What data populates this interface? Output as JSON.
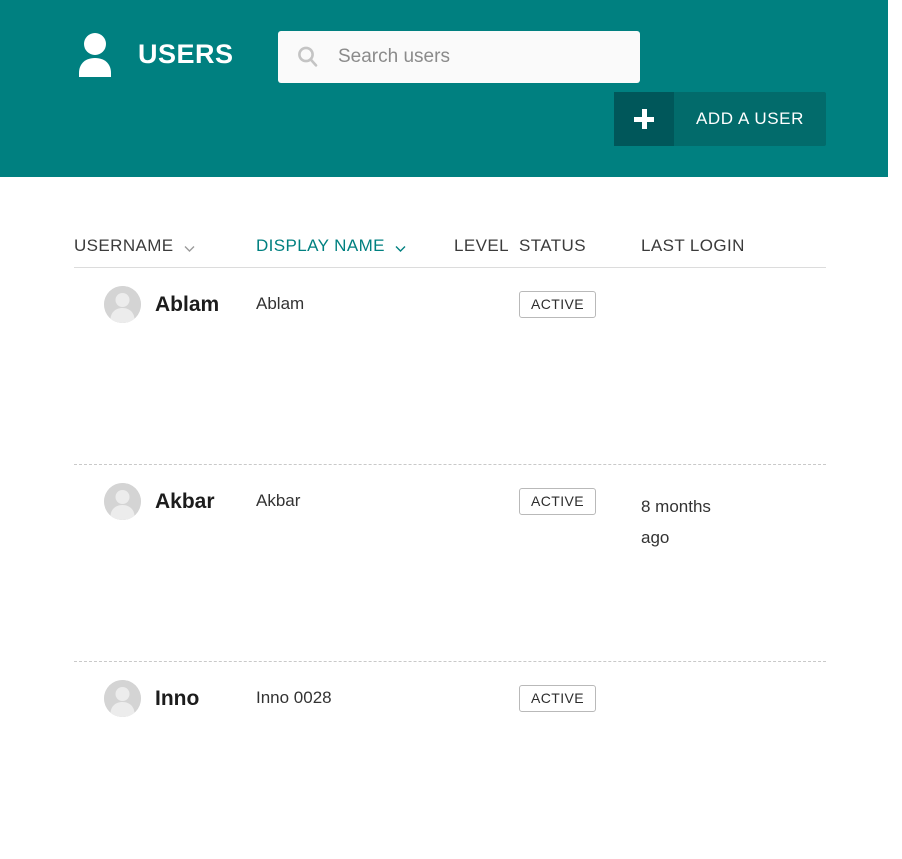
{
  "header": {
    "title": "USERS",
    "user_icon": "person-icon",
    "search": {
      "icon": "search-icon",
      "placeholder": "Search users",
      "value": ""
    },
    "add_user": {
      "icon": "plus-icon",
      "label": "ADD A USER"
    },
    "background_color": "#008080",
    "button_color": "#026b6b",
    "button_icon_color": "#00575a"
  },
  "table": {
    "columns": [
      {
        "key": "username",
        "label": "USERNAME",
        "sortable": true,
        "active": false,
        "icon": "chevron-down-icon"
      },
      {
        "key": "display",
        "label": "DISPLAY NAME",
        "sortable": true,
        "active": true,
        "icon": "chevron-down-icon"
      },
      {
        "key": "level",
        "label": "LEVEL",
        "sortable": false,
        "active": false,
        "icon": ""
      },
      {
        "key": "status",
        "label": "STATUS",
        "sortable": false,
        "active": false,
        "icon": ""
      },
      {
        "key": "lastlogin",
        "label": "LAST LOGIN",
        "sortable": false,
        "active": false,
        "icon": ""
      }
    ],
    "active_column_color": "#008080",
    "rows": [
      {
        "avatar": "avatar-placeholder-icon",
        "username": "Ablam",
        "display_name": "Ablam",
        "level": "",
        "status": "ACTIVE",
        "last_login": ""
      },
      {
        "avatar": "avatar-placeholder-icon",
        "username": "Akbar",
        "display_name": "Akbar",
        "level": "",
        "status": "ACTIVE",
        "last_login": "8 months ago"
      },
      {
        "avatar": "avatar-placeholder-icon",
        "username": "Inno",
        "display_name": "Inno 0028",
        "level": "",
        "status": "ACTIVE",
        "last_login": ""
      }
    ]
  }
}
